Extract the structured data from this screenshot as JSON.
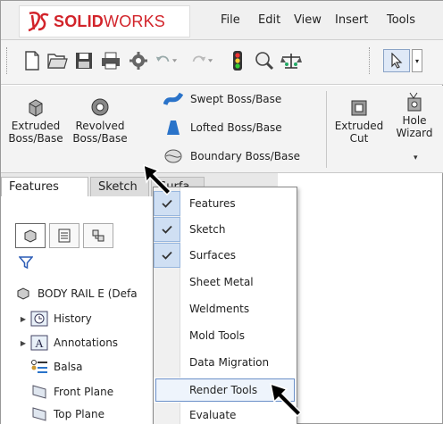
{
  "app": {
    "brand_prefix": "SOLID",
    "brand_suffix": "WORKS"
  },
  "menubar": {
    "items": [
      "File",
      "Edit",
      "View",
      "Insert",
      "Tools"
    ]
  },
  "toolbar": {
    "icons": [
      "new-document-icon",
      "open-folder-icon",
      "save-icon",
      "print-icon",
      "options-gear-icon",
      "undo-icon",
      "redo-icon",
      "traffic-light-icon",
      "rebuild-icon",
      "scale-icon",
      "select-arrow-icon"
    ]
  },
  "command_manager": {
    "extruded_boss": "Extruded\nBoss/Base",
    "revolved_boss": "Revolved\nBoss/Base",
    "swept_boss": "Swept Boss/Base",
    "lofted_boss": "Lofted Boss/Base",
    "boundary_boss": "Boundary Boss/Base",
    "extruded_cut": "Extruded\nCut",
    "hole_wizard": "Hole\nWizard"
  },
  "tabs": {
    "features": "Features",
    "sketch": "Sketch",
    "surfaces_partial": "Surfa"
  },
  "feature_tree": {
    "root": "BODY RAIL E  (Defa",
    "items": [
      {
        "label": "History",
        "expandable": true
      },
      {
        "label": "Annotations",
        "expandable": true
      },
      {
        "label": "Balsa",
        "expandable": false
      },
      {
        "label": "Front Plane",
        "expandable": false
      },
      {
        "label": "Top Plane",
        "expandable": false
      }
    ]
  },
  "context_menu": {
    "items": [
      {
        "label": "Features",
        "checked": true
      },
      {
        "label": "Sketch",
        "checked": true
      },
      {
        "label": "Surfaces",
        "checked": true
      },
      {
        "label": "Sheet Metal",
        "checked": false
      },
      {
        "label": "Weldments",
        "checked": false
      },
      {
        "label": "Mold Tools",
        "checked": false
      },
      {
        "label": "Data Migration",
        "checked": false
      },
      {
        "label": "Render Tools",
        "checked": false,
        "highlighted": true
      },
      {
        "label": "Evaluate",
        "checked": false
      }
    ]
  },
  "colors": {
    "brand_red": "#d2232a",
    "highlight_blue": "#6a8fc8",
    "check_bg": "#cfdff3"
  }
}
